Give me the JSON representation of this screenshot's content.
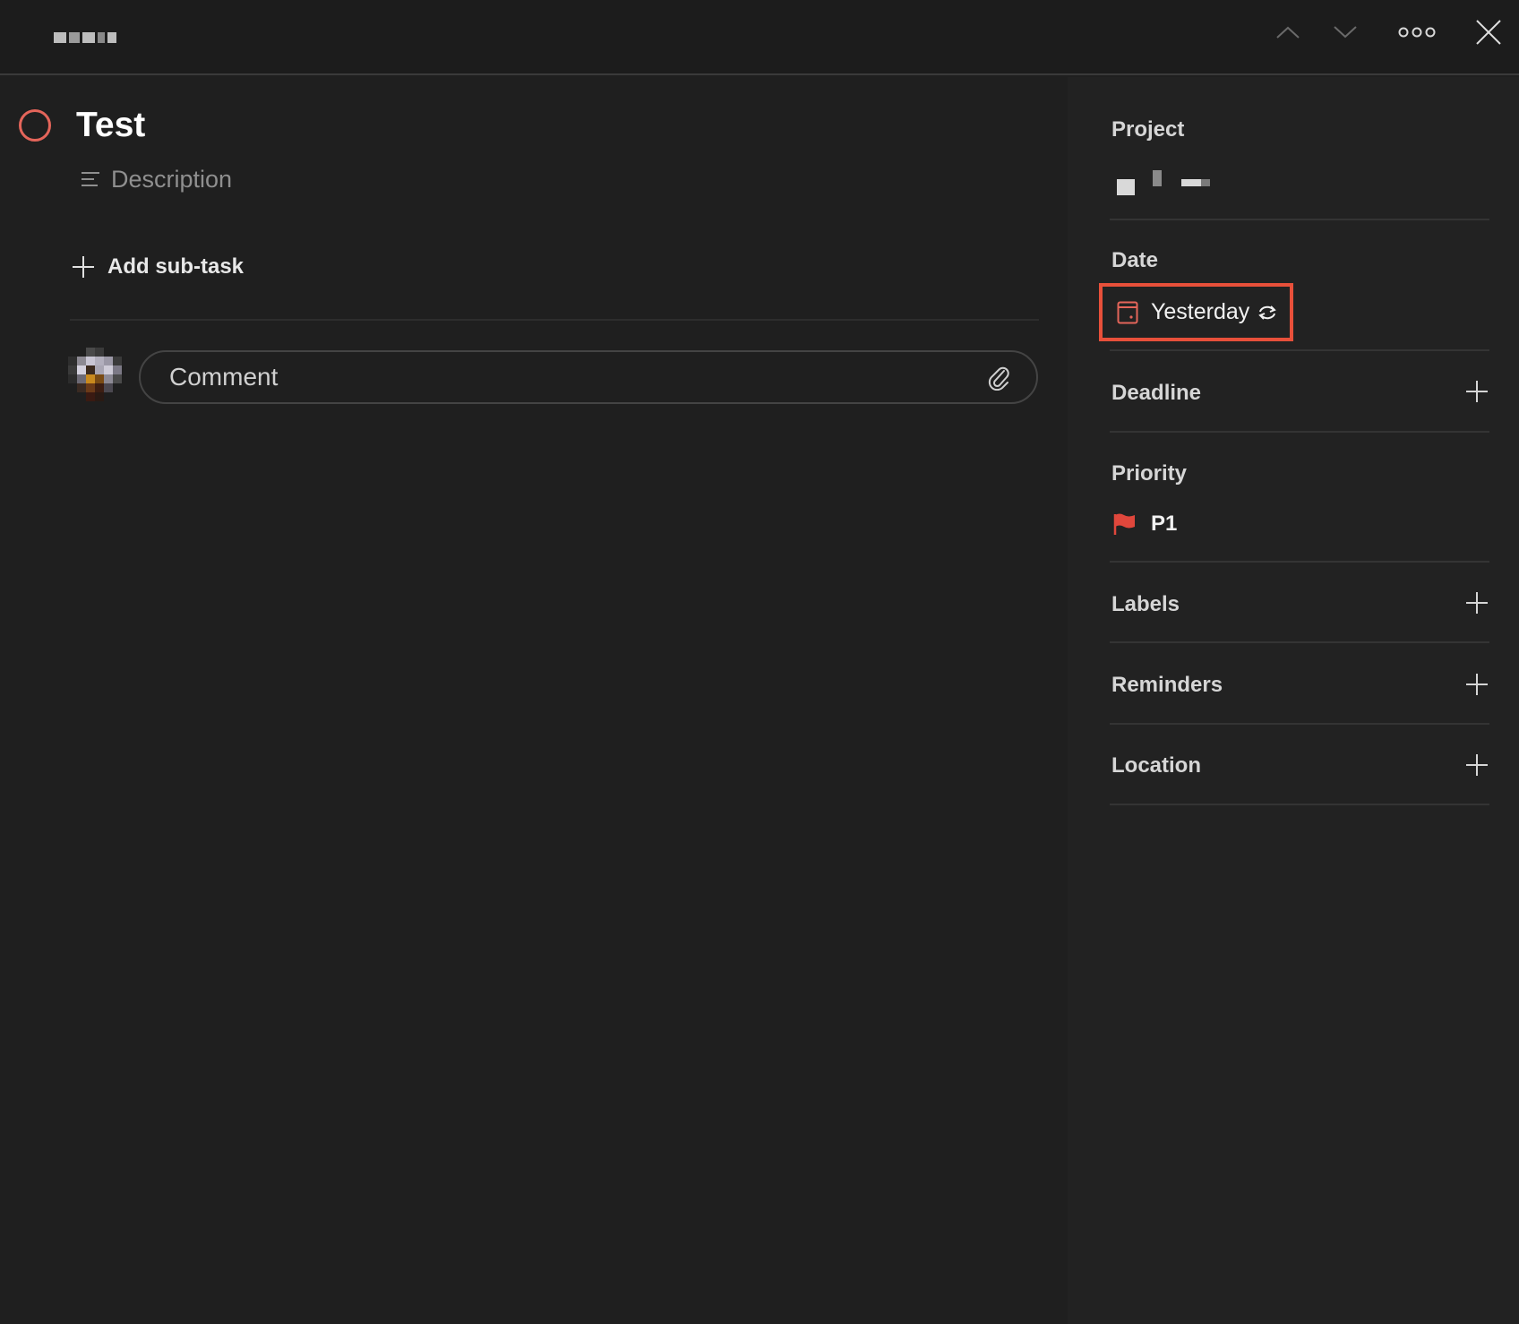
{
  "task": {
    "title": "Test",
    "description_placeholder": "Description",
    "add_subtask_label": "Add sub-task",
    "comment_placeholder": "Comment"
  },
  "sidebar": {
    "project_label": "Project",
    "date_label": "Date",
    "date_value": "Yesterday",
    "deadline_label": "Deadline",
    "priority_label": "Priority",
    "priority_value": "P1",
    "labels_label": "Labels",
    "reminders_label": "Reminders",
    "location_label": "Location"
  },
  "icons": {
    "task_complete": "circle-icon",
    "description": "lines-icon",
    "add_subtask": "plus-icon",
    "attachment": "paperclip-icon",
    "date": "calendar-icon",
    "recurring": "repeat-icon",
    "priority": "flag-icon",
    "nav_up": "chevron-up-icon",
    "nav_down": "chevron-down-icon",
    "more": "more-dots-icon",
    "close": "close-icon"
  },
  "colors": {
    "priority_p1": "#e0473c",
    "accent": "#e4655a",
    "highlight_border": "#e8503a"
  }
}
